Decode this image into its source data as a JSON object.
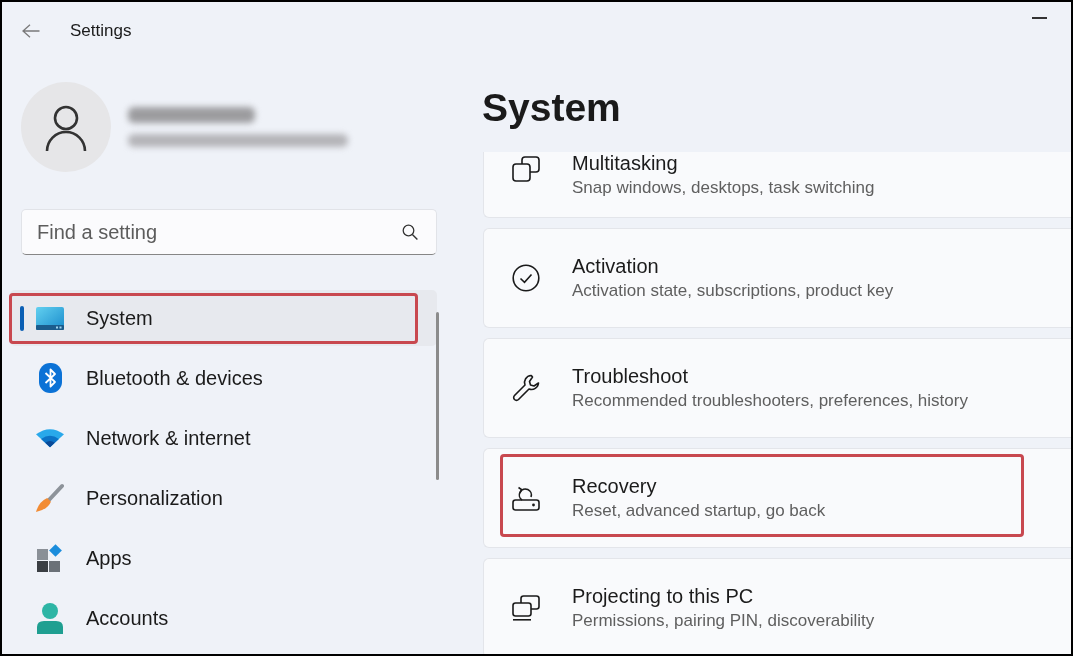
{
  "window": {
    "title": "Settings"
  },
  "search": {
    "placeholder": "Find a setting"
  },
  "sidebar": {
    "items": [
      {
        "label": "System",
        "selected": true,
        "highlighted": true
      },
      {
        "label": "Bluetooth & devices",
        "selected": false,
        "highlighted": false
      },
      {
        "label": "Network & internet",
        "selected": false,
        "highlighted": false
      },
      {
        "label": "Personalization",
        "selected": false,
        "highlighted": false
      },
      {
        "label": "Apps",
        "selected": false,
        "highlighted": false
      },
      {
        "label": "Accounts",
        "selected": false,
        "highlighted": false
      }
    ]
  },
  "page": {
    "title": "System",
    "cards": [
      {
        "title": "Multitasking",
        "description": "Snap windows, desktops, task switching",
        "highlighted": false
      },
      {
        "title": "Activation",
        "description": "Activation state, subscriptions, product key",
        "highlighted": false
      },
      {
        "title": "Troubleshoot",
        "description": "Recommended troubleshooters, preferences, history",
        "highlighted": false
      },
      {
        "title": "Recovery",
        "description": "Reset, advanced startup, go back",
        "highlighted": true
      },
      {
        "title": "Projecting to this PC",
        "description": "Permissions, pairing PIN, discoverability",
        "highlighted": false
      }
    ]
  }
}
